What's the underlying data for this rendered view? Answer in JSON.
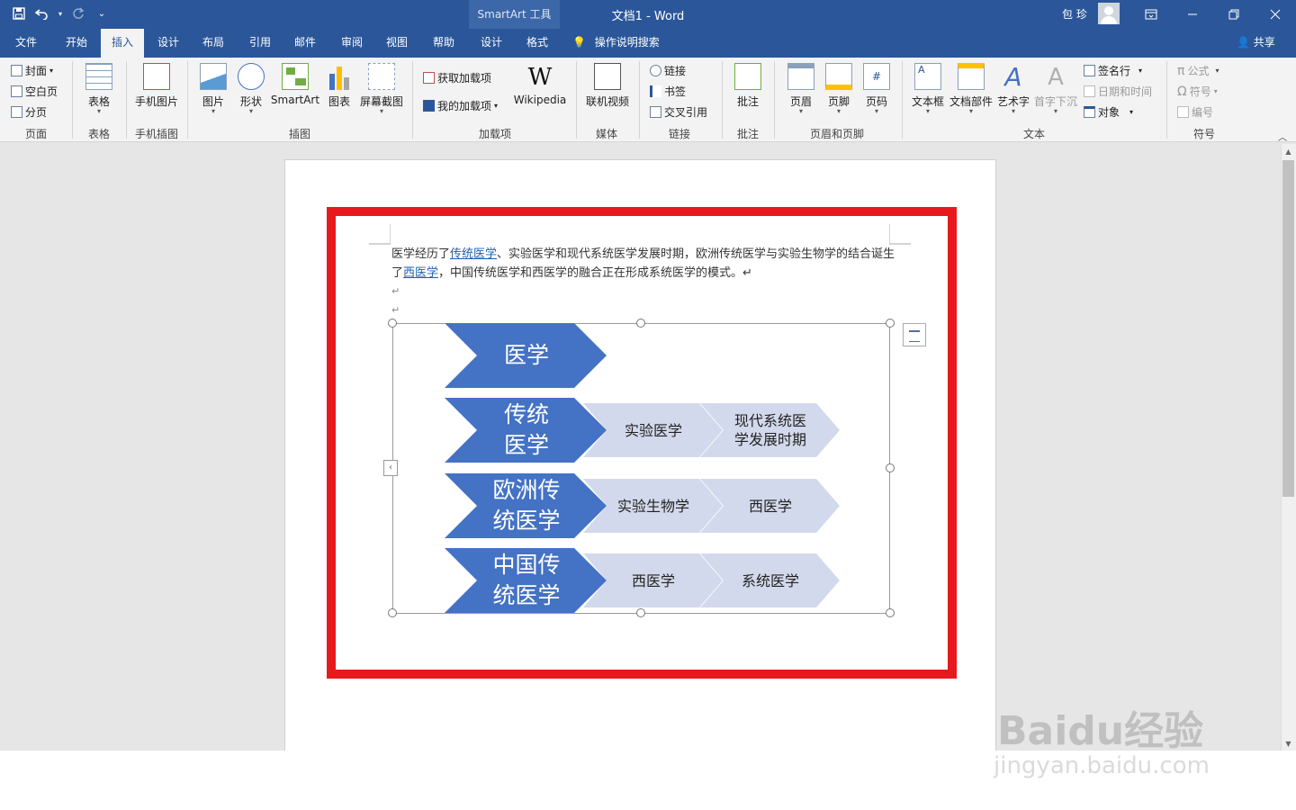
{
  "titlebar": {
    "context_tool": "SmartArt 工具",
    "doc_title": "文档1  -  Word",
    "user_name": "包 珍",
    "qat_icons": [
      "save-icon",
      "undo-icon",
      "redo-icon",
      "customize-icon"
    ]
  },
  "tabs": [
    {
      "label": "文件"
    },
    {
      "label": "开始"
    },
    {
      "label": "插入",
      "active": true
    },
    {
      "label": "设计"
    },
    {
      "label": "布局"
    },
    {
      "label": "引用"
    },
    {
      "label": "邮件"
    },
    {
      "label": "审阅"
    },
    {
      "label": "视图"
    },
    {
      "label": "帮助"
    },
    {
      "label": "设计"
    },
    {
      "label": "格式"
    }
  ],
  "tellme": "操作说明搜索",
  "share": "共享",
  "ribbon": {
    "pages": {
      "cover": "封面",
      "blank": "空白页",
      "break": "分页",
      "label": "页面"
    },
    "tables": {
      "table": "表格",
      "label": "表格"
    },
    "phone": {
      "phone_pic": "手机图片",
      "label": "手机插图"
    },
    "illustrations": {
      "picture": "图片",
      "shapes": "形状",
      "smartart": "SmartArt",
      "chart": "图表",
      "screenshot": "屏幕截图",
      "label": "插图"
    },
    "addins": {
      "get": "获取加载项",
      "my": "我的加载项",
      "wikipedia": "Wikipedia",
      "label": "加载项"
    },
    "media": {
      "video": "联机视频",
      "label": "媒体"
    },
    "links": {
      "link": "链接",
      "bookmark": "书签",
      "crossref": "交叉引用",
      "label": "链接"
    },
    "comments": {
      "comment": "批注",
      "label": "批注"
    },
    "header_footer": {
      "header": "页眉",
      "footer": "页脚",
      "page_number": "页码",
      "label": "页眉和页脚"
    },
    "text": {
      "textbox": "文本框",
      "quickparts": "文档部件",
      "wordart": "艺术字",
      "dropcap": "首字下沉",
      "signature": "签名行",
      "datetime": "日期和时间",
      "object": "对象",
      "label": "文本"
    },
    "symbols": {
      "equation": "公式",
      "symbol": "符号",
      "number": "编号",
      "label": "符号"
    }
  },
  "document": {
    "para_pre": "医学经历了",
    "link1": "传统医学",
    "para_mid": "、实验医学和现代系统医学发展时期，欧洲传统医学与实验生物学的结合诞生了",
    "link2": "西医学",
    "para_post": "，中国传统医学和西医学的融合正在形成系统医学的模式。↵",
    "return_mark": "↵"
  },
  "smartart": {
    "rows": [
      {
        "main": "医学",
        "items": []
      },
      {
        "main": "传统\n医学",
        "items": [
          "实验医学",
          "现代系统医\n学发展时期"
        ]
      },
      {
        "main": "欧洲传\n统医学",
        "items": [
          "实验生物学",
          "西医学"
        ]
      },
      {
        "main": "中国传\n统医学",
        "items": [
          "西医学",
          "系统医学"
        ]
      }
    ],
    "dark_color": "#4472c4",
    "light_color": "#d3d9ec"
  },
  "watermark": {
    "logo": "Baidu经验",
    "url": "jingyan.baidu.com"
  },
  "colors": {
    "accent": "#2b579a",
    "highlight_box": "#e8191d"
  }
}
